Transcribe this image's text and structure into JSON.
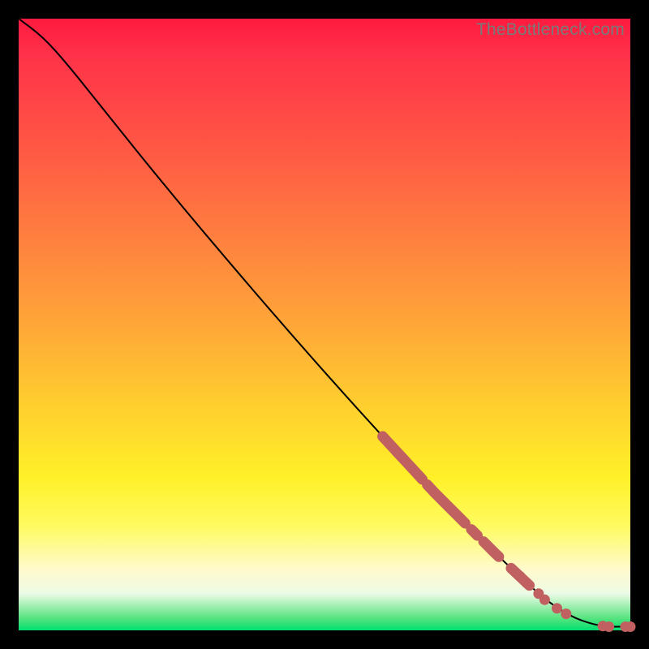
{
  "attribution": "TheBottleneck.com",
  "chart_data": {
    "type": "line",
    "title": "",
    "xlabel": "",
    "ylabel": "",
    "xlim": [
      0,
      100
    ],
    "ylim": [
      0,
      100
    ],
    "grid": false,
    "legend": false,
    "series": [
      {
        "name": "curve",
        "kind": "line",
        "x": [
          0,
          4,
          8,
          14,
          22,
          32,
          44,
          56,
          68,
          78,
          86,
          90,
          92,
          94,
          95.5,
          97,
          98,
          100
        ],
        "y": [
          100,
          97,
          92.5,
          85,
          75,
          63,
          49,
          35.5,
          22.5,
          12.5,
          5,
          2.5,
          1.6,
          1.0,
          0.7,
          0.6,
          0.6,
          0.6
        ]
      },
      {
        "name": "highlight-band",
        "kind": "segments_on_curve",
        "segments": [
          {
            "x0": 59.5,
            "x1": 66.0
          },
          {
            "x0": 66.8,
            "x1": 73.0
          },
          {
            "x0": 74.0,
            "x1": 75.0
          },
          {
            "x0": 76.0,
            "x1": 78.5
          },
          {
            "x0": 80.5,
            "x1": 83.5
          }
        ]
      },
      {
        "name": "highlight-points",
        "kind": "scatter",
        "points": [
          {
            "x": 82.0,
            "y": 8.8
          },
          {
            "x": 83.0,
            "y": 7.8
          },
          {
            "x": 85.0,
            "y": 6.0
          },
          {
            "x": 86.0,
            "y": 5.0
          },
          {
            "x": 88.0,
            "y": 3.6
          },
          {
            "x": 89.5,
            "y": 2.7
          },
          {
            "x": 95.5,
            "y": 0.7
          },
          {
            "x": 96.5,
            "y": 0.6
          },
          {
            "x": 99.2,
            "y": 0.6
          },
          {
            "x": 100.0,
            "y": 0.6
          }
        ]
      }
    ]
  }
}
